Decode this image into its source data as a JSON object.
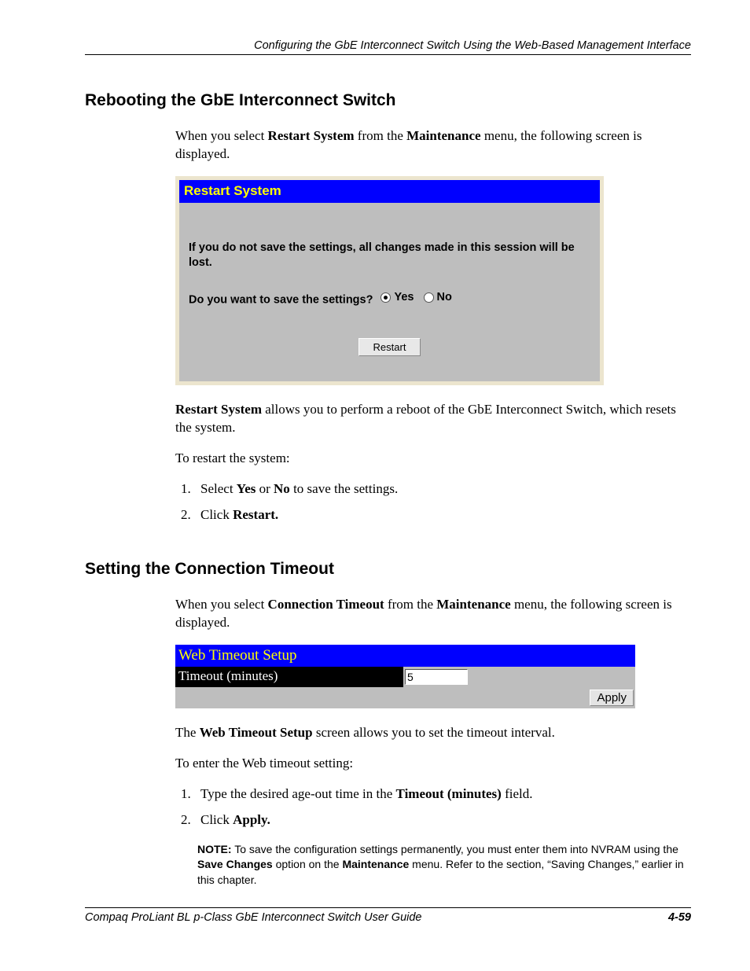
{
  "header": {
    "chapter_title": "Configuring the GbE Interconnect Switch Using the Web-Based Management Interface"
  },
  "section1": {
    "heading": "Rebooting the GbE Interconnect Switch",
    "intro_pre": "When you select ",
    "intro_b1": "Restart System",
    "intro_mid": " from the ",
    "intro_b2": "Maintenance",
    "intro_post": " menu, the following screen is displayed.",
    "panel_title": "Restart System",
    "panel_warning": "If you do not save the settings, all changes made in this session will be lost.",
    "panel_question": "Do you want to save the settings?",
    "radio_yes": "Yes",
    "radio_no": "No",
    "restart_button": "Restart",
    "after_b1": "Restart System",
    "after_text": " allows you to perform a reboot of the GbE Interconnect Switch, which resets the system.",
    "steps_intro": "To restart the system:",
    "step1_pre": "Select ",
    "step1_b1": "Yes",
    "step1_mid": " or ",
    "step1_b2": "No",
    "step1_post": " to save the settings.",
    "step2_pre": "Click ",
    "step2_b1": "Restart."
  },
  "section2": {
    "heading": "Setting the Connection Timeout",
    "intro_pre": "When you select ",
    "intro_b1": "Connection Timeout",
    "intro_mid": " from the ",
    "intro_b2": "Maintenance",
    "intro_post": " menu, the following screen is displayed.",
    "panel_title": "Web Timeout Setup",
    "panel_label": "Timeout (minutes)",
    "panel_value": "5",
    "apply_button": "Apply",
    "after_pre": "The ",
    "after_b1": "Web Timeout Setup",
    "after_post": " screen allows you to set the timeout interval.",
    "steps_intro": "To enter the Web timeout setting:",
    "step1_pre": "Type the desired age-out time in the ",
    "step1_b1": "Timeout (minutes)",
    "step1_post": " field.",
    "step2_pre": "Click ",
    "step2_b1": "Apply.",
    "note_label": "NOTE:",
    "note_text1": "  To save the configuration settings permanently, you must enter them into NVRAM using the ",
    "note_b1": "Save Changes",
    "note_text2": " option on the ",
    "note_b2": "Maintenance",
    "note_text3": " menu. Refer to the section, “Saving Changes,” earlier in this chapter."
  },
  "footer": {
    "doc_title": "Compaq ProLiant BL p-Class GbE Interconnect Switch User Guide",
    "page_num": "4-59"
  }
}
